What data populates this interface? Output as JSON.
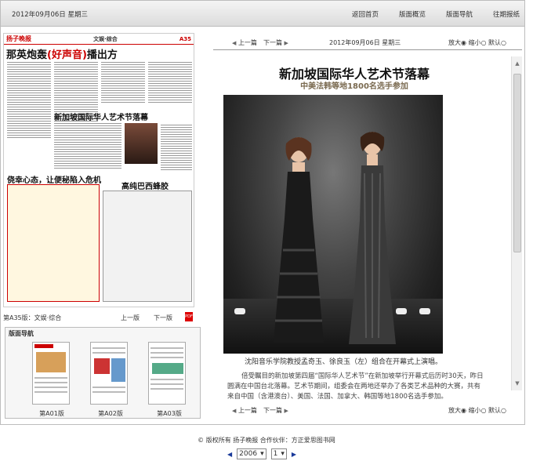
{
  "topbar": {
    "date": "2012年09月06日  星期三",
    "nav": [
      "返回首页",
      "版面概览",
      "版面导航",
      "往期报纸"
    ]
  },
  "page": {
    "logo": "扬子晚报",
    "section": "文娱·综合",
    "number": "A35",
    "headline_prefix": "那英炮轰",
    "headline_em": "(好声音)",
    "headline_suffix": "播出方",
    "sub_headline": "新加坡国际华人艺术节落幕",
    "ad_headline": "侥幸心态，让便秘陷入危机",
    "ad_headline2": "高纯巴西蜂胶"
  },
  "page_nav": {
    "label": "第A35版：文娱·综合",
    "prev": "上一版",
    "next": "下一版",
    "pdf_icon": "PDF"
  },
  "layout_nav": {
    "title": "版面导航",
    "thumbs": [
      "第A01版",
      "第A02版",
      "第A03版"
    ]
  },
  "article": {
    "top_prev": "上一篇",
    "top_next": "下一篇",
    "date": "2012年09月06日  星期三",
    "zoom_big": "放大",
    "zoom_small": "缩小",
    "zoom_default": "默认",
    "title": "新加坡国际华人艺术节落幕",
    "subtitle": "中美法韩等地1800名选手参加",
    "caption": "沈阳音乐学院教授孟奇玉、徐良玉（左）组合在开幕式上演唱。",
    "body": "倍受瞩目的新加坡第四届“国际华人艺术节”在新加坡举行开幕式后历时30天，昨日圆满在中国台北落幕。艺术节期间，组委会在两地还举办了各类艺术品种的大赛，共有来自中国（含港澳台）、美国、法国、加拿大、韩国等地1800名选手参加。"
  },
  "footer": {
    "copyright": "© 版权所有  扬子晚报    合作伙伴：方正爱思图书网",
    "year": "2006",
    "month": "1"
  }
}
